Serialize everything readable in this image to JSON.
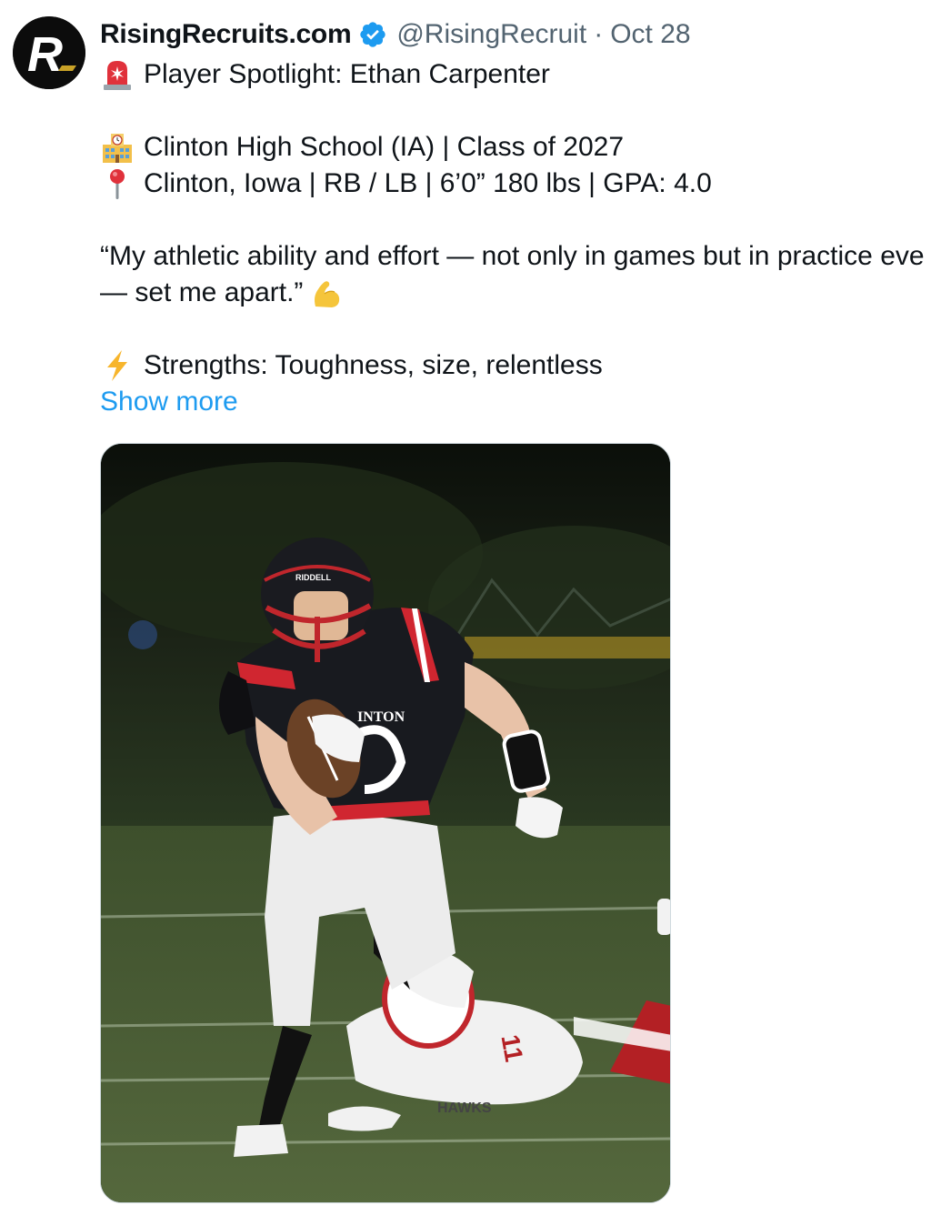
{
  "author": {
    "display_name": "RisingRecruits.com",
    "handle": "@RisingRecruit",
    "separator": "·",
    "date": "Oct 28",
    "avatar_letter": "R",
    "verified": true,
    "verified_color": "#1d9bf0"
  },
  "tweet": {
    "line1": "Player Spotlight: Ethan Carpenter",
    "line1_icon": "siren-emoji",
    "line2": "Clinton High School (IA) | Class of 2027",
    "line2_icon": "school-building-emoji",
    "line3": "Clinton, Iowa | RB / LB | 6’0” 180 lbs | GPA: 4.0",
    "line3_icon": "round-pushpin-emoji",
    "quote_line1": "“My athletic ability and effort — not only in games but in practice eve",
    "quote_line2": "— set me apart.”",
    "quote_icon": "flexed-biceps-emoji",
    "line4": "Strengths: Toughness, size, relentless",
    "line4_icon": "high-voltage-emoji",
    "show_more": "Show more"
  },
  "media": {
    "type": "photo",
    "jersey_text": "INTON",
    "helmet_text": "RIDDELL",
    "jersey_number_opponent": "11",
    "opponent_text": "HAWKS"
  },
  "colors": {
    "link": "#1d9bf0",
    "secondary_text": "#536471",
    "primary_text": "#0f1419"
  }
}
